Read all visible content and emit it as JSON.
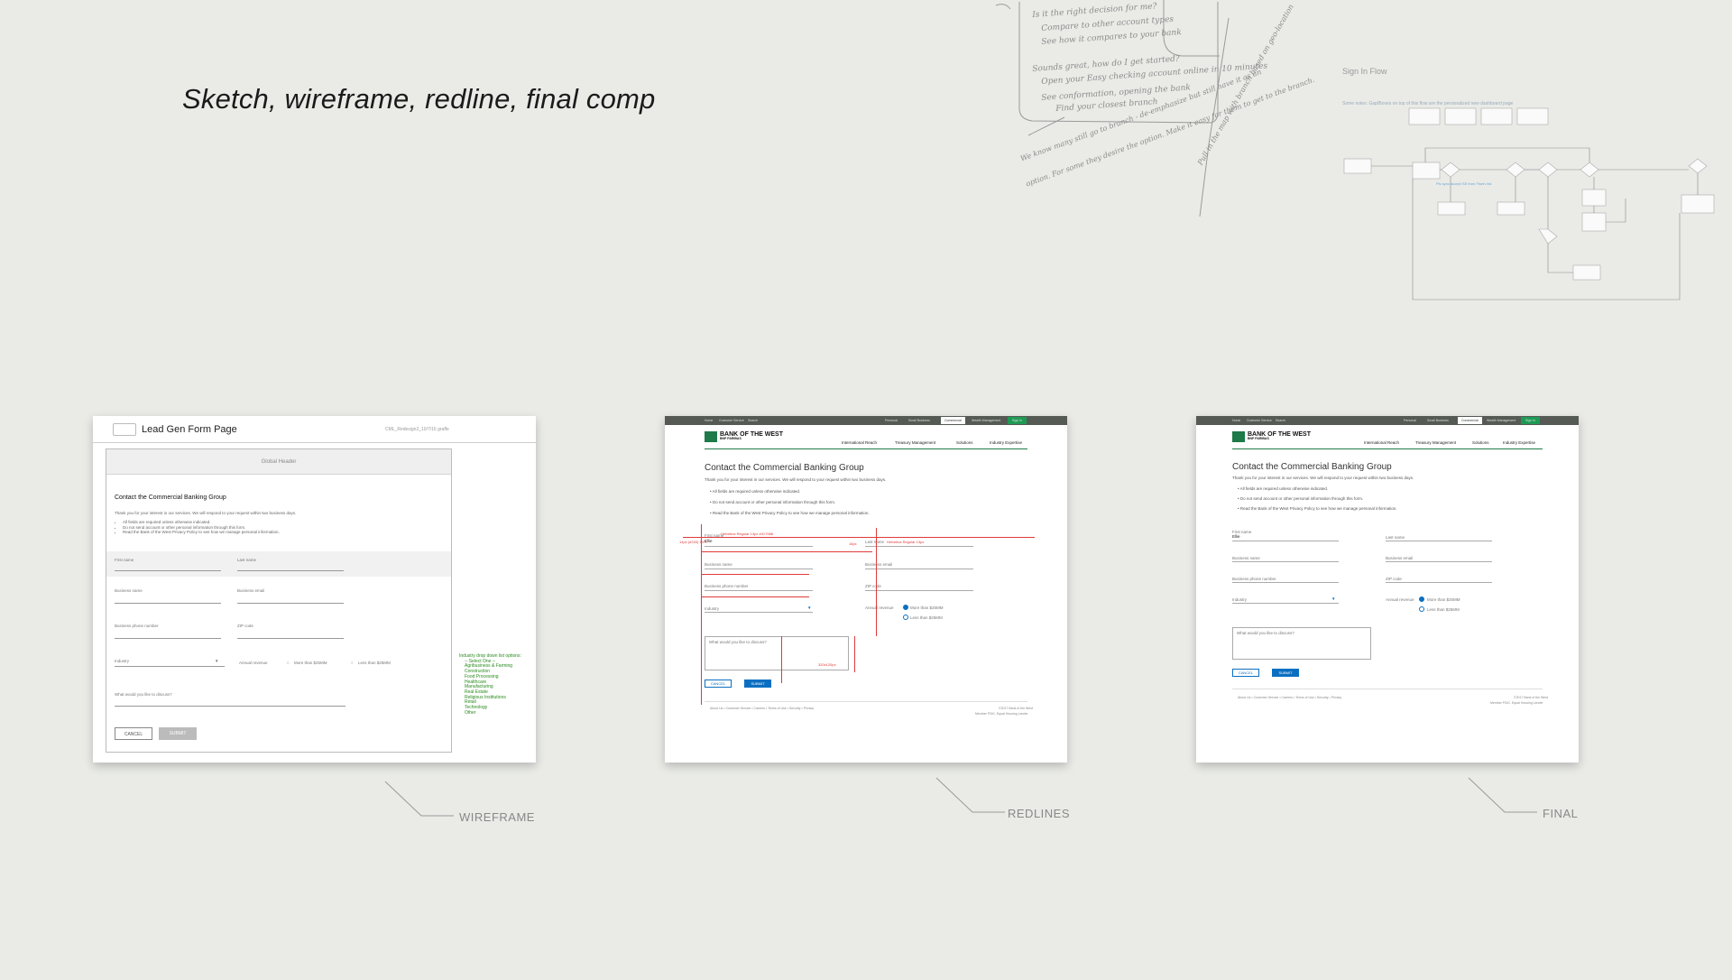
{
  "hero": {
    "title": "Sketch, wireframe, redline, final comp"
  },
  "sketch": {
    "lines": [
      "Is it the right decision for me?",
      "Compare to other account types",
      "See how it compares to your bank",
      "Sounds great, how do I get started?",
      "Open your Easy checking account online in 10 minutes",
      "See conformation, opening the bank",
      "Find your closest branch",
      "We know many still go to branch - de-emphasize but still have it as an",
      "option. For some they desire the option. Make it easy for them to get to the branch.",
      "Pull in the map with branch based on geo-location"
    ]
  },
  "flow": {
    "title": "Sign In Flow",
    "subtitle": "Some notes: Gap/Boxes on top of this flow are the personalized new dashboard page"
  },
  "captions": {
    "wireframe": "WIREFRAME",
    "redlines": "REDLINES",
    "final": "FINAL"
  },
  "wireframe": {
    "page_title": "Lead Gen Form Page",
    "meta": "CML_Redesign2_10/7/16 graffe",
    "global_header": "Global Header",
    "heading": "Contact the Commercial Banking Group",
    "intro": "Thank you for your interest in our services. We will respond to your request within two business days.",
    "bullets": [
      "All fields are required unless otherwise indicated.",
      "Do not send account or other personal information through this form.",
      "Read the Bank of the West Privacy Policy to see how we manage personal information."
    ],
    "fields": {
      "first_name": "First name",
      "last_name": "Last name",
      "business_name": "Business name",
      "business_email": "Business email",
      "business_phone": "Business phone number",
      "zip": "ZIP code",
      "industry": "Industry",
      "annual_revenue": "Annual revenue",
      "more": "More than $25MM",
      "less": "Less than $25MM",
      "discuss": "What would you like to discuss?"
    },
    "cancel": "CANCEL",
    "submit": "SUBMIT",
    "industry_options_title": "Industry drop down list options:",
    "industry_options": [
      "-- Select One --",
      "Agribusiness & Farming",
      "Construction",
      "Food Processing",
      "Healthcare",
      "Manufacturing",
      "Real Estate",
      "Religious Institutions",
      "Retail",
      "Technology",
      "Other"
    ]
  },
  "comp": {
    "top_nav": [
      "Home",
      "Customer Service",
      "Search"
    ],
    "top_nav_right": [
      "Personal",
      "Small Business",
      "Commercial",
      "Wealth Management",
      "Sign In"
    ],
    "logo": "BANK OF THE WEST",
    "logo_sub": "BNP PARIBAS",
    "sub_nav": [
      "International Reach",
      "Treasury Management",
      "Solutions",
      "Industry Expertise"
    ],
    "heading": "Contact the Commercial Banking Group",
    "intro": "Thank you for your interest in our services. We will respond to your request within two business days.",
    "bullets": [
      "• All fields are required unless otherwise indicated.",
      "• Do not send account or other personal information through this form.",
      "• Read the Bank of the West Privacy Policy to see how we manage personal information."
    ],
    "fields": {
      "first_name": "First name",
      "first_value": "Ellie",
      "last_name": "Last name",
      "business_name": "Business name",
      "business_email": "Business email",
      "business_phone": "Business phone number",
      "zip": "ZIP code",
      "industry": "Industry",
      "annual_revenue": "Annual revenue",
      "more": "More than $25MM",
      "less": "Less than $25MM",
      "discuss": "What would you like to discuss?"
    },
    "cancel": "CANCEL",
    "submit": "SUBMIT",
    "footer_links": "About Us  •  Customer Service  •  Careers  •  Terms of Use  •  Security  •  Privacy",
    "footer_right": "©2017 Bank of the West",
    "footer_right2": "Member FDIC. Equal Housing Lender",
    "redline_notes": [
      "Helvetica Regular 13px #417986",
      "Helvetica Regular 13px",
      "14px (#333) 13%",
      "16px",
      "320x120px"
    ]
  }
}
